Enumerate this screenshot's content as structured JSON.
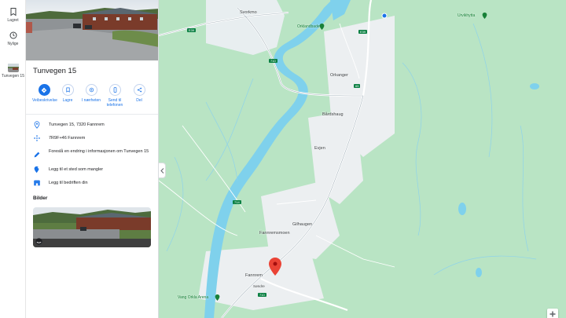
{
  "rail": {
    "saved_label": "Lagret",
    "recent_label": "Nylige",
    "recent_place_label": "Tunvegen 15"
  },
  "place": {
    "title": "Tunvegen 15",
    "actions": [
      {
        "label": "Veibeskrivelse",
        "icon": "directions-icon"
      },
      {
        "label": "Lagre",
        "icon": "bookmark-icon"
      },
      {
        "label": "I nærheten",
        "icon": "nearby-icon"
      },
      {
        "label": "Send til telefonen",
        "icon": "phone-icon"
      },
      {
        "label": "Del",
        "icon": "share-icon"
      }
    ],
    "address": "Tunvegen 15, 7320 Fannrem",
    "plus_code": "7R9F+46 Fannrem",
    "suggest_edit": "Foreslå en endring i informasjonen om Tunvegen 15",
    "add_missing_place": "Legg til et sted som mangler",
    "add_business": "Legg til bedriften din",
    "photos_title": "Bilder"
  },
  "map": {
    "labels": {
      "svorkmo": "Svorkmo",
      "orkanger": "Orkanger",
      "bardshaug": "Bårdshaug",
      "evjen": "Evjen",
      "gilhaugen": "Gilhaugen",
      "fannremsmoen": "Fannremsmoen",
      "fannrem": "Fannrem",
      "sander": "Søndre"
    },
    "poi": {
      "orkdalsbadet": "Orklandbadet",
      "urvikhytta": "Urvikhytta",
      "vang": "Vang Orkla Arena"
    },
    "roads": [
      "E39",
      "E39",
      "710",
      "65",
      "714",
      "710"
    ],
    "colors": {
      "land": "#b9e4c4",
      "water": "#7fd1ec",
      "urban": "#eceff1",
      "road": "#ffffff",
      "pin": "#ea4335",
      "accent": "#1a73e8"
    }
  }
}
